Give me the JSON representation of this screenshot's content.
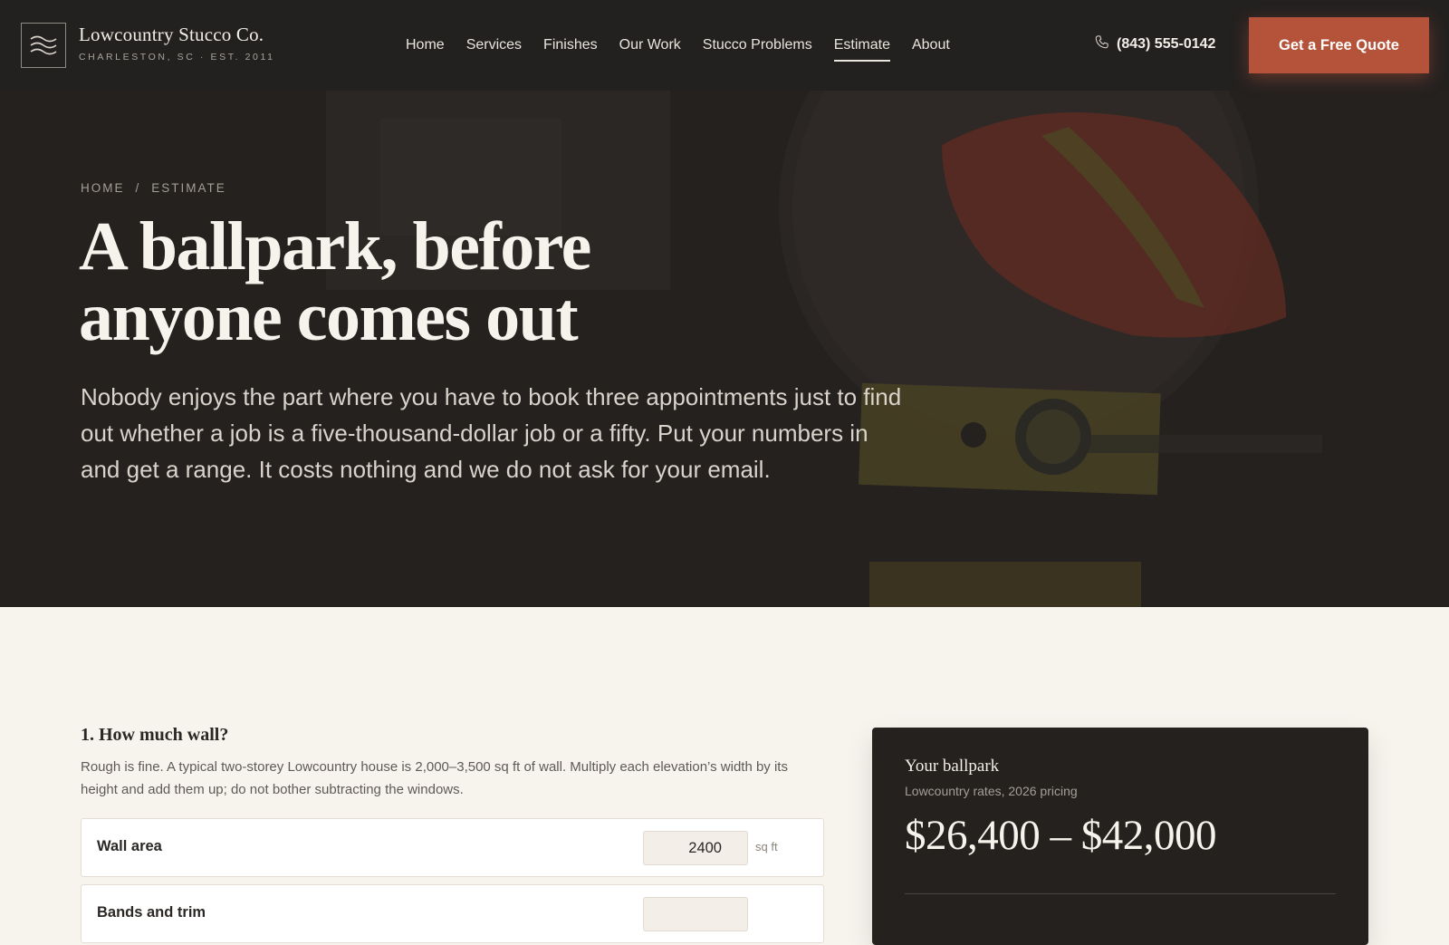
{
  "nav": {
    "brand_name": "Lowcountry Stucco Co.",
    "brand_sub": "CHARLESTON, SC · EST. 2011",
    "items": [
      {
        "label": "Home"
      },
      {
        "label": "Services"
      },
      {
        "label": "Finishes"
      },
      {
        "label": "Our Work"
      },
      {
        "label": "Stucco Problems"
      },
      {
        "label": "Estimate",
        "active": true
      },
      {
        "label": "About"
      }
    ],
    "phone": "(843) 555-0142",
    "cta": "Get a Free Quote"
  },
  "hero": {
    "breadcrumb": [
      "HOME",
      "/",
      "ESTIMATE"
    ],
    "title_line1": "A ballpark, before",
    "title_line2": "anyone comes out",
    "text": "Nobody enjoys the part where you have to book three appointments just to find out whether a job is a five-thousand-dollar job or a fifty. Put your numbers in and get a range. It costs nothing and we do not ask for your email."
  },
  "estimator": {
    "question_title": "1. How much wall?",
    "question_help": "Rough is fine. A typical two-storey Lowcountry house is 2,000–3,500 sq ft of wall. Multiply each elevation’s width by its height and add them up; do not bother subtracting the windows.",
    "wall_area": {
      "label": "Wall area",
      "value": "2400",
      "unit": "sq ft"
    },
    "next_row_label": "Bands and trim"
  },
  "result": {
    "title": "Your ballpark",
    "subtitle": "Lowcountry rates, 2026 pricing",
    "range": "$26,400 – $42,000"
  },
  "colors": {
    "accent": "#b5533a",
    "dark": "#232120",
    "cream": "#f7f4ee"
  }
}
